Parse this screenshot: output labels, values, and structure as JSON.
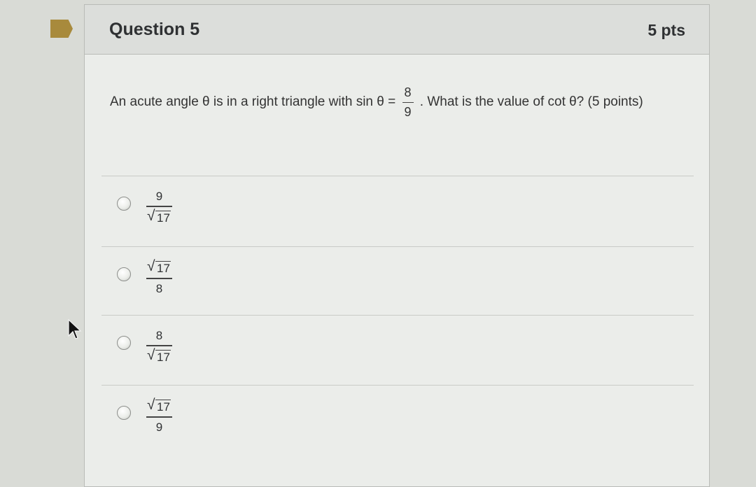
{
  "question": {
    "title": "Question 5",
    "points": "5 pts",
    "prompt_before": "An acute angle θ is in a right triangle with sin θ =",
    "given_fraction": {
      "numerator": "8",
      "denominator": "9"
    },
    "prompt_after": ". What is the value of cot θ? (5 points)"
  },
  "answers": [
    {
      "numerator": "9",
      "denominator_radicand": "17",
      "radical_in": "denominator",
      "selected": false
    },
    {
      "numerator_radicand": "17",
      "denominator": "8",
      "radical_in": "numerator",
      "selected": false
    },
    {
      "numerator": "8",
      "denominator_radicand": "17",
      "radical_in": "denominator",
      "selected": false
    },
    {
      "numerator_radicand": "17",
      "denominator": "9",
      "radical_in": "numerator",
      "selected": false
    }
  ],
  "colors": {
    "flag": "#a88a3c",
    "card": "#ebedea",
    "header": "#dcdedb"
  },
  "icons": {
    "flag": "bookmark-flag-icon",
    "cursor": "mouse-pointer-icon"
  }
}
